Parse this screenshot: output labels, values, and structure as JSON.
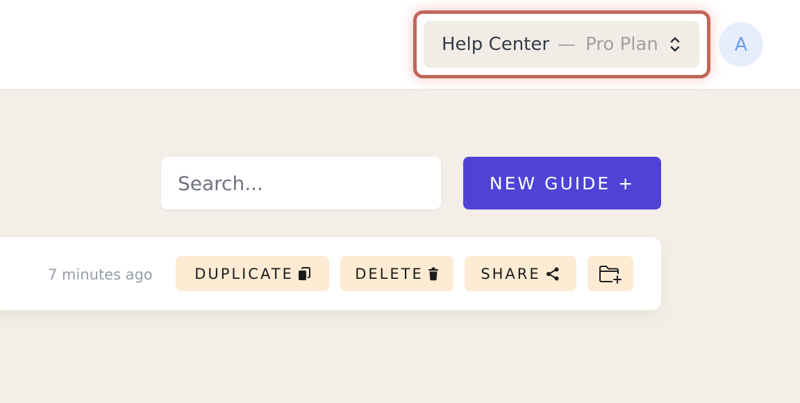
{
  "header": {
    "workspace": {
      "name": "Help Center",
      "separator": "—",
      "plan": "Pro Plan",
      "icon": "chevron-up-down-icon"
    },
    "avatar": {
      "initial": "A"
    }
  },
  "toolbar": {
    "search_placeholder": "Search...",
    "new_guide_label": "NEW GUIDE +"
  },
  "guide_row": {
    "timestamp": "7 minutes ago",
    "actions": {
      "duplicate": {
        "label": "DUPLICATE",
        "icon": "copy-icon"
      },
      "delete": {
        "label": "DELETE",
        "icon": "trash-icon"
      },
      "share": {
        "label": "SHARE",
        "icon": "share-icon"
      },
      "move": {
        "icon": "folder-plus-icon"
      }
    }
  },
  "colors": {
    "accent": "#4f43d6",
    "action_bg": "#fdebd3",
    "page_bg": "#f3efe8",
    "highlight": "#c0675a"
  }
}
